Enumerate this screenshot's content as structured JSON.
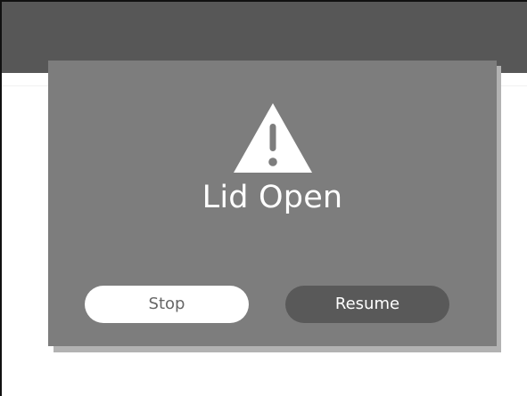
{
  "dialog": {
    "title": "Lid Open",
    "icon": "warning-icon"
  },
  "buttons": {
    "stop_label": "Stop",
    "resume_label": "Resume"
  },
  "colors": {
    "top_bar": "#575757",
    "modal_background": "#7d7d7d",
    "modal_shadow": "#b2b2b2",
    "stop_button": "#ffffff",
    "resume_button": "#595959",
    "title_text": "#ffffff"
  }
}
